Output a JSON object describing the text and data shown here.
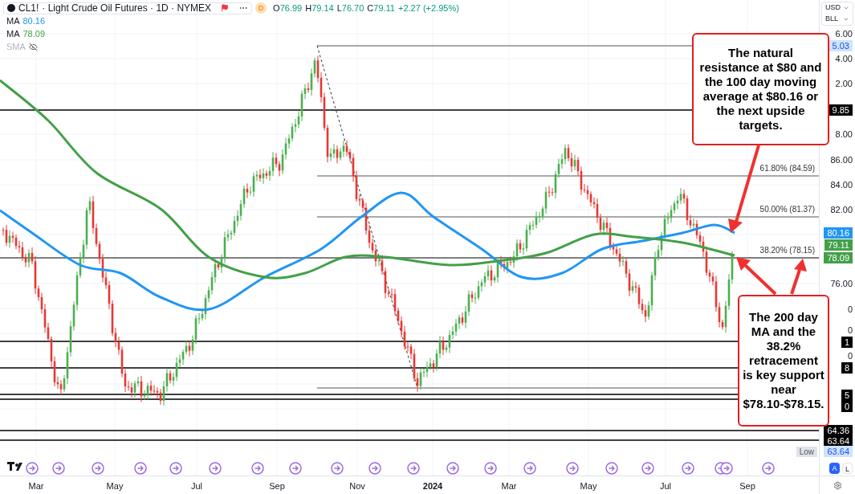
{
  "header": {
    "symbol": "CL1!",
    "title": "· Light Crude Oil Futures · 1D · NYMEX",
    "interval_badge": "D",
    "ohlc": [
      {
        "label": "O",
        "value": "76.99"
      },
      {
        "label": "H",
        "value": "79.14"
      },
      {
        "label": "L",
        "value": "76.70"
      },
      {
        "label": "C",
        "value": "79.11"
      }
    ],
    "change": "+2.27 (+2.95%)"
  },
  "legend": [
    {
      "name": "MA",
      "value": "80.16",
      "color": "#2196f3",
      "visible": true
    },
    {
      "name": "MA",
      "value": "78.09",
      "color": "#43a047",
      "visible": true
    },
    {
      "name": "SMA",
      "visible": false
    }
  ],
  "currency_menu": [
    "USD",
    "BLL"
  ],
  "price_axis": [
    {
      "label": "6.00",
      "kind": "tick"
    },
    {
      "label": "5.03",
      "kind": "soft_tag",
      "color": "#cfe3fb"
    },
    {
      "label": "4.00",
      "kind": "tick"
    },
    {
      "label": "2.00",
      "kind": "tick"
    },
    {
      "label": "9.85",
      "kind": "tag",
      "color": "#000000"
    },
    {
      "label": "8.00",
      "kind": "tick"
    },
    {
      "label": "86.00",
      "kind": "tick"
    },
    {
      "label": "84.00",
      "kind": "tick"
    },
    {
      "label": "82.00",
      "kind": "tick"
    },
    {
      "label": "80.16",
      "kind": "tag",
      "color": "#2196f3"
    },
    {
      "label": "79.11",
      "kind": "tag",
      "color": "#43a047"
    },
    {
      "label": "78.09",
      "kind": "tag",
      "color": "#43a047"
    },
    {
      "label": "76.00",
      "kind": "tick"
    },
    {
      "label": "0",
      "kind": "tick"
    },
    {
      "label": "0",
      "kind": "tick"
    },
    {
      "label": "1",
      "kind": "tag",
      "color": "#000000"
    },
    {
      "label": "0",
      "kind": "tick"
    },
    {
      "label": "8",
      "kind": "tag",
      "color": "#000000"
    },
    {
      "label": "5",
      "kind": "tag",
      "color": "#000000"
    },
    {
      "label": "0",
      "kind": "tag",
      "color": "#000000"
    },
    {
      "label": "64.36",
      "kind": "tag",
      "color": "#000000"
    },
    {
      "label": "63.64",
      "kind": "tag",
      "color": "#000000"
    },
    {
      "label": "63.64",
      "kind": "soft_tag",
      "color": "#cfe3fb"
    }
  ],
  "fib_levels": [
    "61.80% (84.59)",
    "50.00% (81.37)",
    "38.20% (78.15)"
  ],
  "callouts": [
    "The natural resistance at $80 and the 100 day moving average at $80.16 or the next upside targets.",
    "The 200 day MA and the 38.2% retracement is key support near $78.10-$78.15."
  ],
  "low_marker": "Low",
  "scale_buttons": [
    {
      "label": "A",
      "selected": true
    },
    {
      "label": "L",
      "selected": false
    }
  ],
  "time_axis": [
    {
      "label": "Mar",
      "kind": "month"
    },
    {
      "label": "May",
      "kind": "month"
    },
    {
      "label": "Jul",
      "kind": "month"
    },
    {
      "label": "Sep",
      "kind": "month"
    },
    {
      "label": "Nov",
      "kind": "month"
    },
    {
      "label": "2024",
      "kind": "year"
    },
    {
      "label": "Mar",
      "kind": "month"
    },
    {
      "label": "May",
      "kind": "month"
    },
    {
      "label": "Jul",
      "kind": "month"
    },
    {
      "label": "Sep",
      "kind": "month"
    }
  ]
}
